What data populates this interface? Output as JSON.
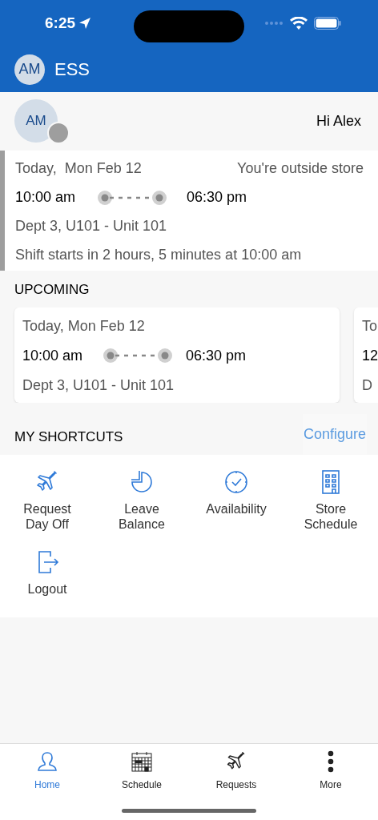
{
  "status_bar": {
    "time": "6:25"
  },
  "app_bar": {
    "avatar": "AM",
    "title": "ESS"
  },
  "greeting": {
    "avatar": "AM",
    "text": "Hi Alex"
  },
  "current_shift": {
    "date": "Today,  Mon Feb 12",
    "location_status": "You're outside store",
    "start": "10:00 am",
    "end": "06:30 pm",
    "department": "Dept 3, U101 - Unit 101",
    "countdown": "Shift starts in 2 hours, 5 minutes at 10:00 am"
  },
  "upcoming": {
    "title": "UPCOMING",
    "cards": [
      {
        "date": "Today, Mon Feb 12",
        "start": "10:00 am",
        "end": "06:30 pm",
        "department": "Dept 3, U101 - Unit 101"
      },
      {
        "date": "To",
        "start": "12",
        "department": "D"
      }
    ]
  },
  "shortcuts": {
    "title": "MY SHORTCUTS",
    "configure": "Configure",
    "items": [
      {
        "kind": "plane",
        "label": "Request\nDay Off"
      },
      {
        "kind": "pie",
        "label": "Leave\nBalance"
      },
      {
        "kind": "clock",
        "label": "Availability"
      },
      {
        "kind": "building",
        "label": "Store\nSchedule"
      },
      {
        "kind": "logout",
        "label": "Logout"
      }
    ]
  },
  "tab_bar": [
    {
      "kind": "person",
      "label": "Home",
      "selected": true
    },
    {
      "kind": "calendar",
      "label": "Schedule",
      "selected": false
    },
    {
      "kind": "plane",
      "label": "Requests",
      "selected": false
    },
    {
      "kind": "dots",
      "label": "More",
      "selected": false
    }
  ]
}
